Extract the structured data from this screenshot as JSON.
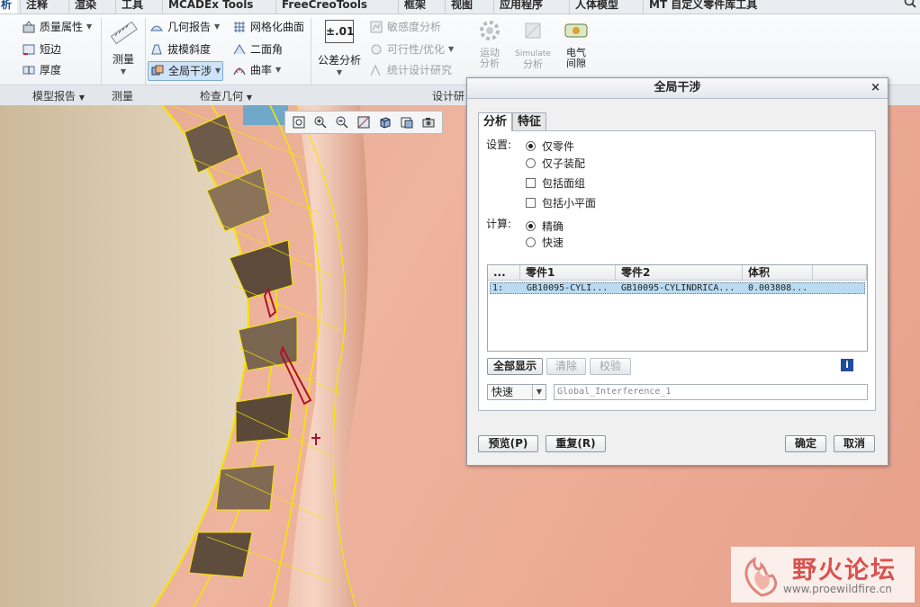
{
  "tabs": [
    {
      "label": "析",
      "active": true
    },
    {
      "label": "注释"
    },
    {
      "label": "渲染"
    },
    {
      "label": "工具"
    },
    {
      "label": "MCADEx Tools"
    },
    {
      "label": "FreeCreoTools"
    },
    {
      "label": "框架"
    },
    {
      "label": "视图"
    },
    {
      "label": "应用程序"
    },
    {
      "label": "人体模型"
    },
    {
      "label": "MT 自定义零件库工具"
    }
  ],
  "ribbon": {
    "model_report": {
      "mass_props": "质量属性",
      "short_edge": "短边",
      "thickness": "厚度",
      "group": "模型报告"
    },
    "measure": {
      "label": "测量",
      "group": "测量"
    },
    "inspect": {
      "geo_report": "几何报告",
      "draft": "拔模斜度",
      "global_interference": "全局干涉",
      "mesh_surface": "网格化曲面",
      "dihedral": "二面角",
      "curvature": "曲率",
      "group": "检查几何"
    },
    "design": {
      "tolerance_icon": "±.01",
      "tolerance": "公差分析",
      "sensitivity": "敏感度分析",
      "feasibility": "可行性/优化",
      "statistical": "统计设计研究",
      "group": "设计研"
    },
    "motion": {
      "line1": "运动",
      "line2": "分析"
    },
    "simulate": {
      "line1": "Simulate",
      "line2": "分析"
    },
    "electric": {
      "line1": "电气",
      "line2": "间隙"
    }
  },
  "dialog": {
    "title": "全局干涉",
    "tabs": [
      "分析",
      "特征"
    ],
    "settings_label": "设置:",
    "settings": {
      "parts_only": "仅零件",
      "subassembly_only": "仅子装配",
      "include_quilts": "包括面组",
      "include_facets": "包括小平面"
    },
    "compute_label": "计算:",
    "compute": {
      "exact": "精确",
      "quick": "快速"
    },
    "table": {
      "headers": [
        "...",
        "零件1",
        "零件2",
        "体积"
      ],
      "rows": [
        {
          "index": "1:",
          "part1": "GB10095-CYLI...",
          "part2": "GB10095-CYLINDRICA...",
          "volume": "0.003808..."
        }
      ]
    },
    "buttons": {
      "show_all": "全部显示",
      "clear": "清除",
      "check": "校验"
    },
    "method_value": "快速",
    "name_value": "Global_Interference_1",
    "footer": {
      "preview": "预览(P)",
      "repeat": "重复(R)",
      "ok": "确定",
      "cancel": "取消"
    },
    "close_glyph": "×"
  },
  "watermark": {
    "name": "野火论坛",
    "url": "www.proewildfire.cn"
  },
  "colors": {
    "accent": "#1a4f8a",
    "selection": "#b9dcf3",
    "gear_outline": "#f5e600",
    "copper": "#e9a58c"
  }
}
